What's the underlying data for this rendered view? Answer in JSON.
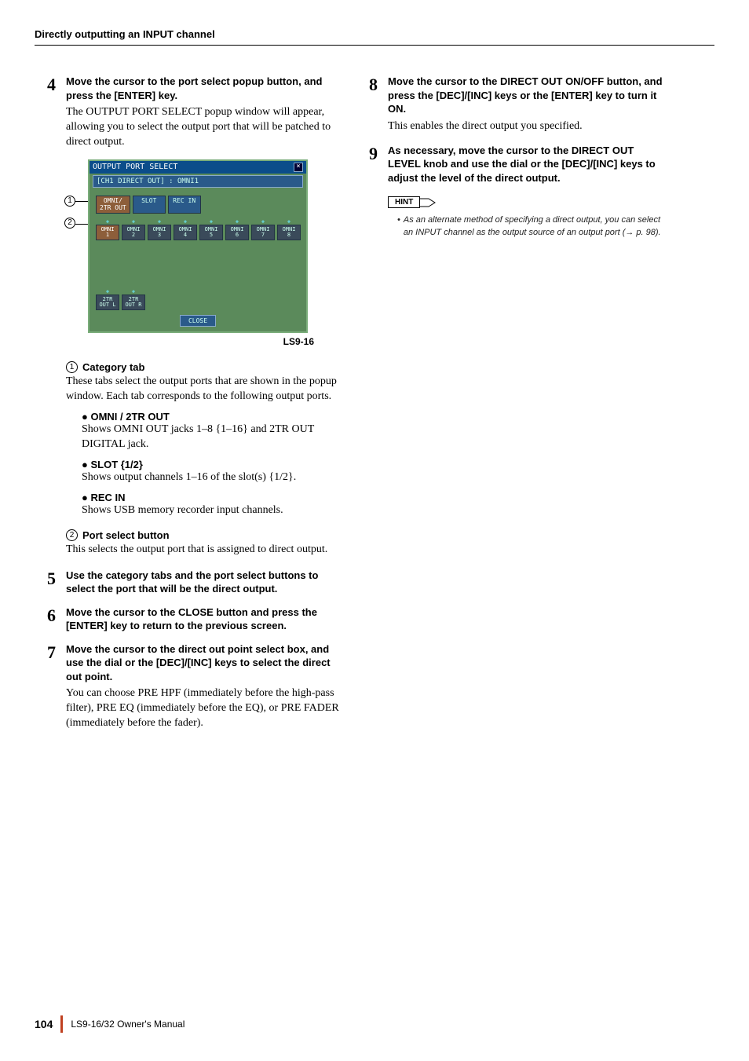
{
  "header": {
    "running_head": "Directly outputting an INPUT channel"
  },
  "steps": {
    "s4": {
      "num": "4",
      "title": "Move the cursor to the port select popup button, and press the [ENTER] key.",
      "text": "The OUTPUT PORT SELECT popup window will appear, allowing you to select the output port that will be patched to direct output."
    },
    "s5": {
      "num": "5",
      "title": "Use the category tabs and the port select buttons to select the port that will be the direct output."
    },
    "s6": {
      "num": "6",
      "title": "Move the cursor to the CLOSE button and press the [ENTER] key to return to the previous screen."
    },
    "s7": {
      "num": "7",
      "title": "Move the cursor to the direct out point select box, and use the dial or the [DEC]/[INC] keys to select the direct out point.",
      "text": "You can choose PRE HPF (immediately before the high-pass filter), PRE EQ (immediately before the EQ), or PRE FADER (immediately before the fader)."
    },
    "s8": {
      "num": "8",
      "title": "Move the cursor to the DIRECT OUT ON/OFF button, and press the [DEC]/[INC] keys or the [ENTER] key to turn it ON.",
      "text": "This enables the direct output you specified."
    },
    "s9": {
      "num": "9",
      "title": "As necessary, move the cursor to the DIRECT OUT LEVEL knob and use the dial or the [DEC]/[INC] keys to adjust the level of the direct output."
    }
  },
  "popup": {
    "title": "OUTPUT PORT SELECT",
    "subtitle": "[CH1 DIRECT OUT] : OMNI1",
    "tabs": [
      "OMNI/\n2TR OUT",
      "SLOT",
      "REC IN"
    ],
    "active_tab": 0,
    "ports_row1": [
      "OMNI\n1",
      "OMNI\n2",
      "OMNI\n3",
      "OMNI\n4",
      "OMNI\n5",
      "OMNI\n6",
      "OMNI\n7",
      "OMNI\n8"
    ],
    "selected_port": 0,
    "ports_row2": [
      "2TR\nOUT L",
      "2TR\nOUT R"
    ],
    "close": "CLOSE",
    "model_label": "LS9-16"
  },
  "callouts": {
    "c1": {
      "marker": "1",
      "title": "Category tab",
      "text": "These tabs select the output ports that are shown in the popup window. Each tab corresponds to the following output ports."
    },
    "c2": {
      "marker": "2",
      "title": "Port select button",
      "text": "This selects the output port that is assigned to direct output."
    }
  },
  "bullets": {
    "b1": {
      "head": "● OMNI / 2TR OUT",
      "text": "Shows OMNI OUT jacks 1–8 {1–16} and 2TR OUT DIGITAL jack."
    },
    "b2": {
      "head": "● SLOT {1/2}",
      "text": "Shows output channels 1–16 of the slot(s) {1/2}."
    },
    "b3": {
      "head": "● REC IN",
      "text": "Shows USB memory recorder input channels."
    }
  },
  "hint": {
    "label": "HINT",
    "text": "As an alternate method of specifying a direct output, you can select an INPUT channel as the output source of an output port (→ p. 98)."
  },
  "footer": {
    "page": "104",
    "manual": "LS9-16/32  Owner's Manual"
  }
}
